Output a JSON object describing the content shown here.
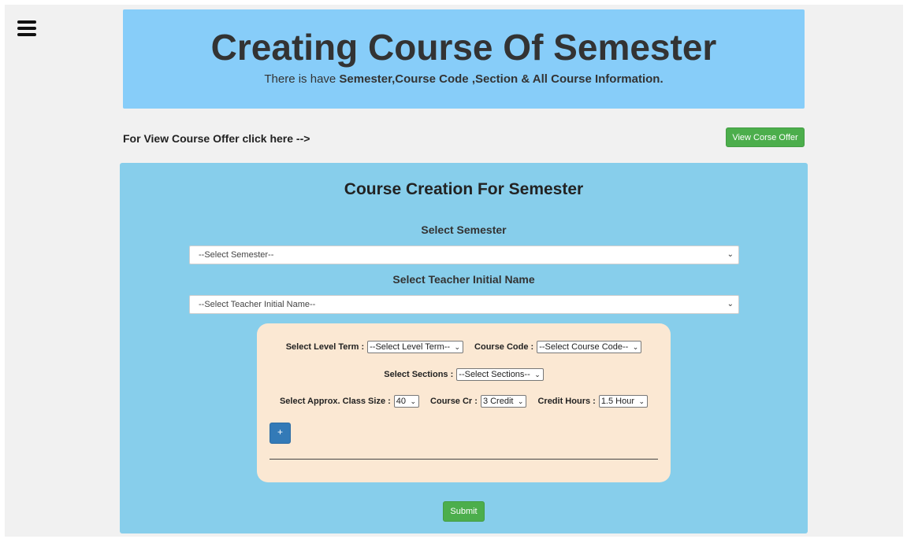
{
  "banner": {
    "title": "Creating Course Of Semester",
    "subtitle_plain": "There is have ",
    "subtitle_bold": "Semester,Course Code ,Section & All Course Information."
  },
  "offer": {
    "text": "For View Course Offer click here -->",
    "button_label": "View Corse Offer"
  },
  "form": {
    "title": "Course Creation For Semester",
    "semester_label": "Select Semester",
    "semester_value": "--Select Semester--",
    "teacher_label": "Select Teacher Initial Name",
    "teacher_value": "--Select Teacher Initial Name--",
    "level_term_label": "Select Level Term :",
    "level_term_value": "--Select Level Term--",
    "course_code_label": "Course Code :",
    "course_code_value": "--Select Course Code--",
    "sections_label": "Select Sections :",
    "sections_value": "--Select Sections--",
    "class_size_label": "Select Approx. Class Size :",
    "class_size_value": "40",
    "course_cr_label": "Course Cr :",
    "course_cr_value": "3 Credit",
    "credit_hours_label": "Credit Hours :",
    "credit_hours_value": "1.5 Hour",
    "add_button_label": "+",
    "submit_label": "Submit"
  },
  "colors": {
    "banner_bg": "#87cdf9",
    "panel_bg": "#87ceeb",
    "inner_bg": "#fbe8d3",
    "green_button": "#4cae4c",
    "blue_button": "#337ab7"
  },
  "icons": {
    "menu": "hamburger-icon",
    "select_arrow": "chevron-down-icon"
  }
}
